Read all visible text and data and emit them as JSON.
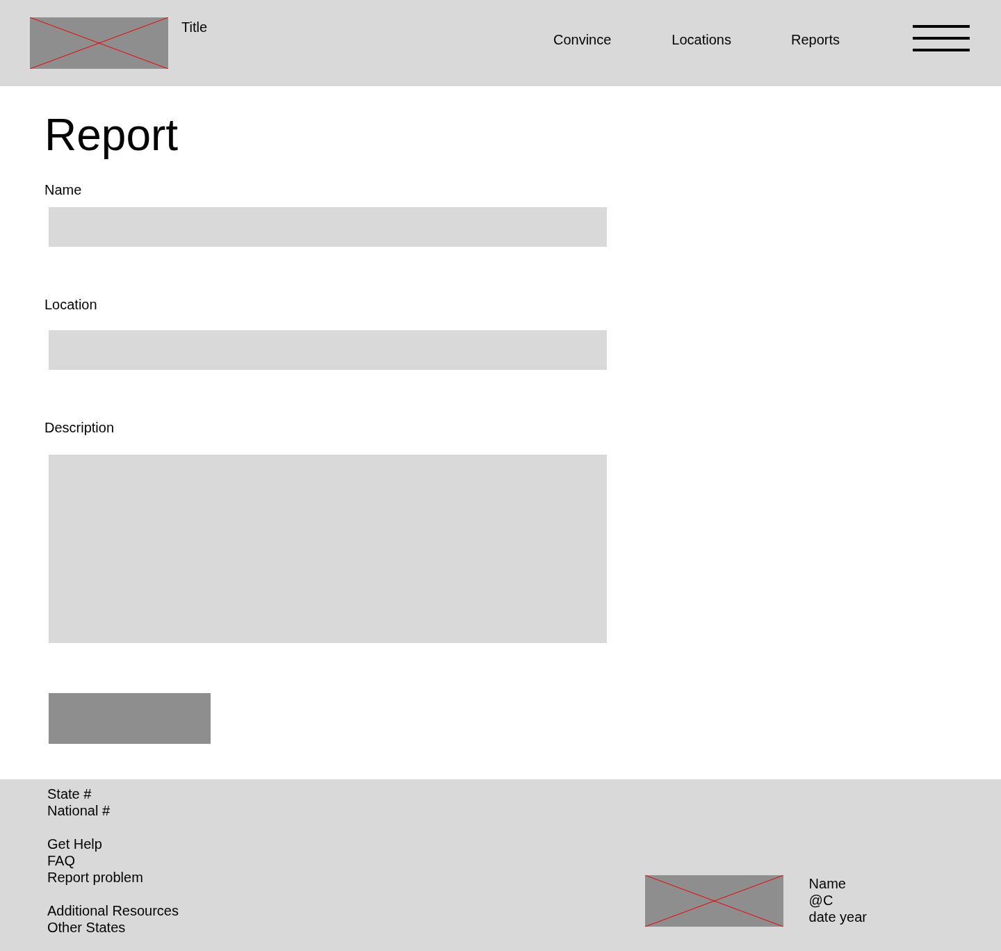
{
  "header": {
    "title": "Title",
    "nav": [
      {
        "label": "Convince"
      },
      {
        "label": "Locations"
      },
      {
        "label": "Reports"
      }
    ]
  },
  "form": {
    "heading": "Report",
    "fields": [
      {
        "label": "Name",
        "kind": "input"
      },
      {
        "label": "Location",
        "kind": "input"
      },
      {
        "label": "Description",
        "kind": "textarea"
      }
    ]
  },
  "footer": {
    "groups": [
      [
        "State #",
        "National #"
      ],
      [
        "Get Help",
        "FAQ",
        "Report problem"
      ],
      [
        "Additional Resources",
        "Other States"
      ]
    ],
    "info": [
      "Name",
      "@C",
      "date year"
    ]
  }
}
